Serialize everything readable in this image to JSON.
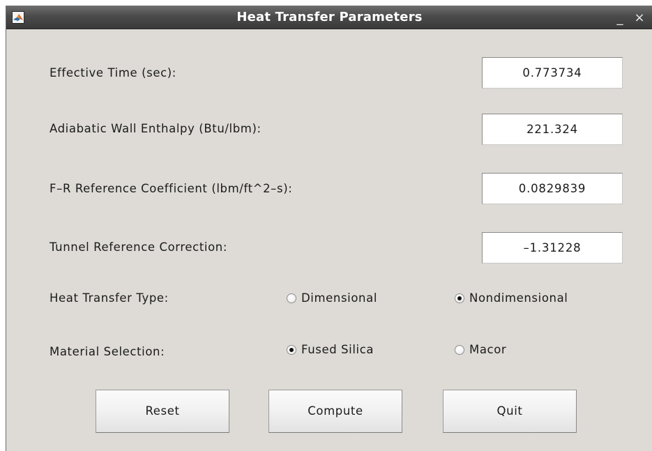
{
  "window": {
    "title": "Heat Transfer Parameters",
    "minimize_glyph": "_",
    "close_glyph": "×",
    "app_icon": "matlab-icon"
  },
  "fields": {
    "effective_time": {
      "label": "Effective Time (sec):",
      "value": "0.773734"
    },
    "adiabatic_wall_enthalpy": {
      "label": "Adiabatic Wall Enthalpy (Btu/lbm):",
      "value": "221.324"
    },
    "fr_reference_coefficient": {
      "label": "F–R Reference Coefficient (lbm/ft^2–s):",
      "value": "0.0829839"
    },
    "tunnel_reference_correction": {
      "label": "Tunnel Reference Correction:",
      "value": "–1.31228"
    }
  },
  "heat_transfer_type": {
    "label": "Heat Transfer Type:",
    "options": [
      {
        "label": "Dimensional",
        "selected": false
      },
      {
        "label": "Nondimensional",
        "selected": true
      }
    ]
  },
  "material_selection": {
    "label": "Material Selection:",
    "options": [
      {
        "label": "Fused Silica",
        "selected": true
      },
      {
        "label": "Macor",
        "selected": false
      }
    ]
  },
  "buttons": {
    "reset": "Reset",
    "compute": "Compute",
    "quit": "Quit"
  },
  "colors": {
    "panel": "#dedbd7",
    "titlebar": "#4b4b4b",
    "title_text": "#ffffff"
  }
}
